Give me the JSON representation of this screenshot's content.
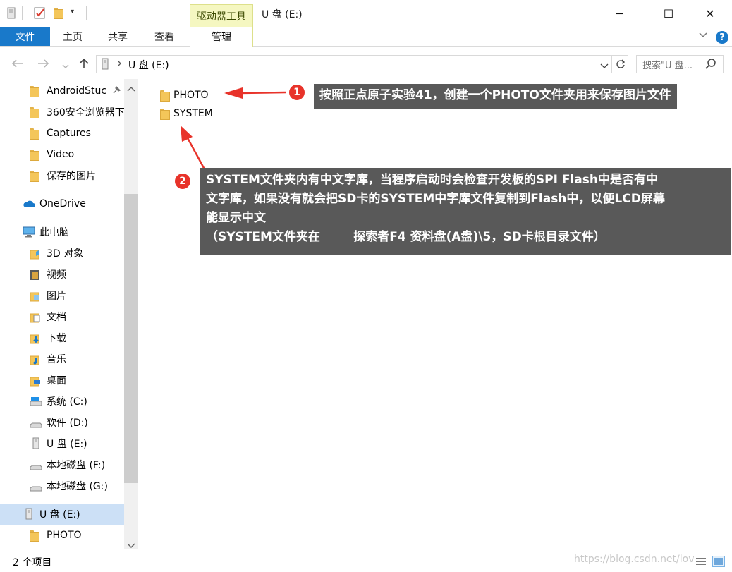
{
  "window": {
    "title": "U 盘 (E:)",
    "tools_tab": "驱动器工具",
    "controls": {
      "minimize": "─",
      "maximize": "☐",
      "close": "✕"
    }
  },
  "ribbon": {
    "file_tab": "文件",
    "tabs": [
      "主页",
      "共享",
      "查看"
    ],
    "manage_tab": "管理"
  },
  "address": {
    "path": "U 盘 (E:)",
    "search_placeholder": "搜索\"U 盘..."
  },
  "sidebar": {
    "items": [
      {
        "label": "AndroidStuc",
        "icon": "folder-icon",
        "pinned": true
      },
      {
        "label": "360安全浏览器下",
        "icon": "folder-icon"
      },
      {
        "label": "Captures",
        "icon": "folder-icon"
      },
      {
        "label": "Video",
        "icon": "folder-icon"
      },
      {
        "label": "保存的图片",
        "icon": "folder-icon"
      },
      {
        "label": "OneDrive",
        "icon": "cloud-icon",
        "root": true
      },
      {
        "label": "此电脑",
        "icon": "computer-icon",
        "root": true
      },
      {
        "label": "3D 对象",
        "icon": "3d-objects-icon"
      },
      {
        "label": "视频",
        "icon": "video-folder-icon"
      },
      {
        "label": "图片",
        "icon": "pictures-folder-icon"
      },
      {
        "label": "文档",
        "icon": "documents-folder-icon"
      },
      {
        "label": "下载",
        "icon": "downloads-folder-icon"
      },
      {
        "label": "音乐",
        "icon": "music-folder-icon"
      },
      {
        "label": "桌面",
        "icon": "desktop-folder-icon"
      },
      {
        "label": "系统 (C:)",
        "icon": "windows-drive-icon"
      },
      {
        "label": "软件 (D:)",
        "icon": "drive-icon"
      },
      {
        "label": "U 盘 (E:)",
        "icon": "usb-drive-icon"
      },
      {
        "label": "本地磁盘 (F:)",
        "icon": "drive-icon"
      },
      {
        "label": "本地磁盘 (G:)",
        "icon": "drive-icon"
      },
      {
        "label": "U 盘 (E:)",
        "icon": "usb-drive-icon",
        "root": true,
        "selected": true
      },
      {
        "label": "PHOTO",
        "icon": "folder-icon"
      }
    ]
  },
  "files": [
    {
      "name": "PHOTO",
      "icon": "folder-icon"
    },
    {
      "name": "SYSTEM",
      "icon": "folder-icon"
    }
  ],
  "annotations": [
    {
      "number": "1",
      "text": "按照正点原子实验41，创建一个PHOTO文件夹用来保存图片文件"
    },
    {
      "number": "2",
      "lines": [
        "SYSTEM文件夹内有中文字库，当程序启动时会检查开发板的SPI Flash中是否有中",
        "文字库，如果没有就会把SD卡的SYSTEM中字库文件复制到Flash中，以便LCD屏幕",
        "能显示中文",
        "（SYSTEM文件夹在        探索者F4 资料盘(A盘)\\5，SD卡根目录文件）"
      ]
    }
  ],
  "status": {
    "item_count": "2 个项目",
    "watermark": "https://blog.csdn.net/lov"
  },
  "colors": {
    "accent": "#1979ca",
    "tools_tab_bg": "#f5f7c1",
    "selection": "#cce0f6",
    "callout_bg": "#595959",
    "badge_red": "#e8332a",
    "arrow_red": "#e8332a"
  }
}
